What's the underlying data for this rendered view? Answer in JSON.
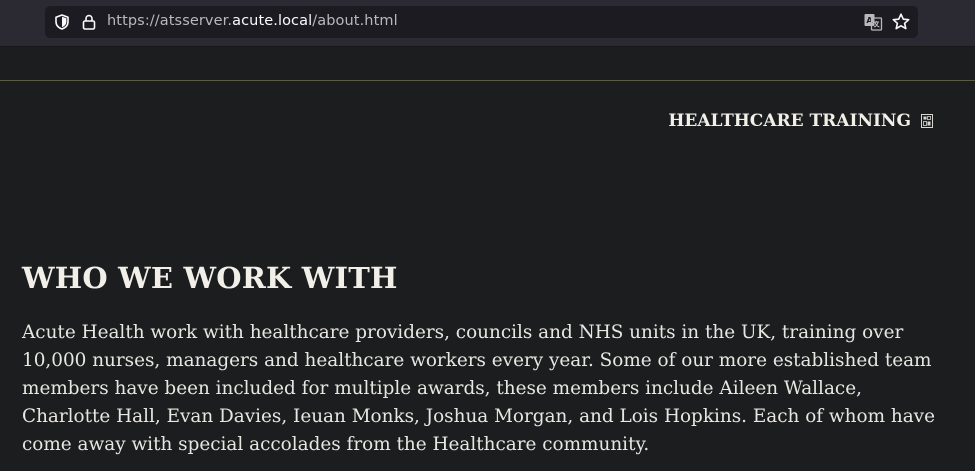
{
  "browser": {
    "url_prefix": "https://atsserver.",
    "url_host": "acute.local",
    "url_path": "/about.html",
    "icons": [
      "shield-icon",
      "lock-icon",
      "translate-icon",
      "bookmark-star-icon"
    ]
  },
  "header": {
    "brand": "HEALTHCARE TRAINING",
    "brand_icon": "broken-image-icon"
  },
  "main": {
    "heading": "WHO WE WORK WITH",
    "paragraph": "Acute Health work with healthcare providers, councils and NHS units in the UK, training over 10,000 nurses, managers and healthcare workers every year. Some of our more established team members have been included for multiple awards, these members include Aileen Wallace, Charlotte Hall, Evan Davies, Ieuan Monks, Joshua Morgan, and Lois Hopkins. Each of whom have come away with special accolades from the Healthcare community."
  },
  "colors": {
    "page_background": "#1b1d1f",
    "toolbar_background": "#2b2a33",
    "urlbar_background": "#1c1b22",
    "text": "#f1efe8",
    "divider": "#5c5b44"
  }
}
